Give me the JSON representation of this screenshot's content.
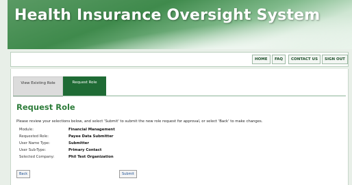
{
  "header": {
    "title": "Health Insurance Oversight System"
  },
  "nav": {
    "home": "HOME",
    "faq": "FAQ",
    "contact": "CONTACT US",
    "signout": "SIGN OUT"
  },
  "tabs": [
    {
      "label": "View Existing Role",
      "active": false
    },
    {
      "label": "Request Role",
      "active": true
    }
  ],
  "page": {
    "title": "Request Role",
    "intro": "Please review your selections below, and select 'Submit' to submit the new role request for approval, or select 'Back' to make changes."
  },
  "summary": [
    {
      "label": "Module:",
      "value": "Financial Management"
    },
    {
      "label": "Requested Role:",
      "value": "Payee Data Submitter"
    },
    {
      "label": "User Name Type:",
      "value": "Submitter"
    },
    {
      "label": "User Sub-Type:",
      "value": "Primary Contact"
    },
    {
      "label": "Selected Company:",
      "value": "Phil Test Organization"
    }
  ],
  "buttons": {
    "back": "Back",
    "submit": "Submit"
  },
  "colors": {
    "accent": "#1f6b35",
    "title": "#2e7d3b"
  }
}
